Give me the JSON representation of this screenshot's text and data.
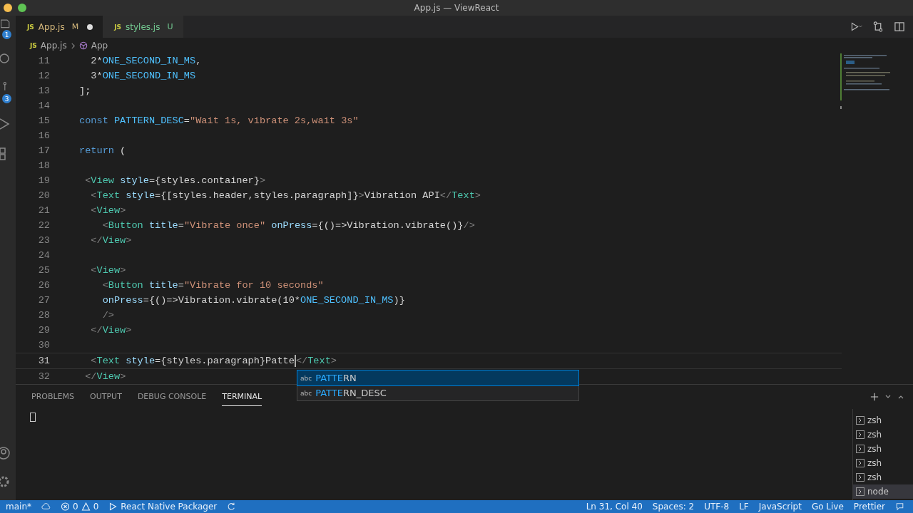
{
  "window": {
    "title": "App.js — ViewReact"
  },
  "activity_badges": [
    {
      "kind": "explorer",
      "count": "1"
    },
    {
      "kind": "scm",
      "count": "3"
    }
  ],
  "tabs": [
    {
      "file_icon": "JS",
      "label": "App.js",
      "status": "M",
      "modified": true,
      "selected": true
    },
    {
      "file_icon": "JS",
      "label": "styles.js",
      "status": "U",
      "modified": false,
      "selected": false
    }
  ],
  "breadcrumb": {
    "file_icon": "JS",
    "file": "App.js",
    "symbol": "App"
  },
  "editor": {
    "lines": [
      {
        "number": "11",
        "current": false,
        "tokens": [
          {
            "kind": "plain",
            "text": "  2*"
          },
          {
            "kind": "const",
            "text": "ONE_SECOND_IN_MS"
          },
          {
            "kind": "plain",
            "text": ","
          }
        ]
      },
      {
        "number": "12",
        "current": false,
        "tokens": [
          {
            "kind": "plain",
            "text": "  3*"
          },
          {
            "kind": "const",
            "text": "ONE_SECOND_IN_MS"
          }
        ]
      },
      {
        "number": "13",
        "current": false,
        "tokens": [
          {
            "kind": "plain",
            "text": "];"
          }
        ]
      },
      {
        "number": "14",
        "current": false
      },
      {
        "number": "15",
        "current": false,
        "tokens": [
          {
            "kind": "keyword",
            "text": "const "
          },
          {
            "kind": "const",
            "text": "PATTERN_DESC"
          },
          {
            "kind": "plain",
            "text": "="
          },
          {
            "kind": "string",
            "text": "\"Wait 1s, vibrate 2s,wait 3s\""
          }
        ]
      },
      {
        "number": "16",
        "current": false
      },
      {
        "number": "17",
        "current": false,
        "tokens": [
          {
            "kind": "keyword",
            "text": "return"
          },
          {
            "kind": "plain",
            "text": " ("
          }
        ]
      },
      {
        "number": "18",
        "current": false
      },
      {
        "number": "19",
        "current": false,
        "tokens": [
          {
            "kind": "punct",
            "text": " <"
          },
          {
            "kind": "tag",
            "text": "View"
          },
          {
            "kind": "attr",
            "text": " style"
          },
          {
            "kind": "plain",
            "text": "={styles.container}"
          },
          {
            "kind": "punct",
            "text": ">"
          }
        ]
      },
      {
        "number": "20",
        "current": false,
        "tokens": [
          {
            "kind": "punct",
            "text": "  <"
          },
          {
            "kind": "tag",
            "text": "Text"
          },
          {
            "kind": "attr",
            "text": " style"
          },
          {
            "kind": "plain",
            "text": "={[styles.header,styles.paragraph]}"
          },
          {
            "kind": "punct",
            "text": ">"
          },
          {
            "kind": "plain",
            "text": "Vibration API"
          },
          {
            "kind": "punct",
            "text": "</"
          },
          {
            "kind": "tag",
            "text": "Text"
          },
          {
            "kind": "punct",
            "text": ">"
          }
        ]
      },
      {
        "number": "21",
        "current": false,
        "tokens": [
          {
            "kind": "punct",
            "text": "  <"
          },
          {
            "kind": "tag",
            "text": "View"
          },
          {
            "kind": "punct",
            "text": ">"
          }
        ]
      },
      {
        "number": "22",
        "current": false,
        "tokens": [
          {
            "kind": "punct",
            "text": "    <"
          },
          {
            "kind": "tag",
            "text": "Button"
          },
          {
            "kind": "attr",
            "text": " title"
          },
          {
            "kind": "plain",
            "text": "="
          },
          {
            "kind": "string",
            "text": "\"Vibrate once\""
          },
          {
            "kind": "attr",
            "text": " onPress"
          },
          {
            "kind": "plain",
            "text": "={()=>Vibration.vibrate()}"
          },
          {
            "kind": "punct",
            "text": "/>"
          }
        ]
      },
      {
        "number": "23",
        "current": false,
        "tokens": [
          {
            "kind": "punct",
            "text": "  </"
          },
          {
            "kind": "tag",
            "text": "View"
          },
          {
            "kind": "punct",
            "text": ">"
          }
        ]
      },
      {
        "number": "24",
        "current": false
      },
      {
        "number": "25",
        "current": false,
        "tokens": [
          {
            "kind": "punct",
            "text": "  <"
          },
          {
            "kind": "tag",
            "text": "View"
          },
          {
            "kind": "punct",
            "text": ">"
          }
        ]
      },
      {
        "number": "26",
        "current": false,
        "tokens": [
          {
            "kind": "punct",
            "text": "    <"
          },
          {
            "kind": "tag",
            "text": "Button"
          },
          {
            "kind": "attr",
            "text": " title"
          },
          {
            "kind": "plain",
            "text": "="
          },
          {
            "kind": "string",
            "text": "\"Vibrate for 10 seconds\""
          }
        ]
      },
      {
        "number": "27",
        "current": false,
        "tokens": [
          {
            "kind": "attr",
            "text": "    onPress"
          },
          {
            "kind": "plain",
            "text": "={()=>Vibration.vibrate(10*"
          },
          {
            "kind": "const",
            "text": "ONE_SECOND_IN_MS"
          },
          {
            "kind": "plain",
            "text": ")}"
          }
        ]
      },
      {
        "number": "28",
        "current": false,
        "tokens": [
          {
            "kind": "punct",
            "text": "    />"
          }
        ]
      },
      {
        "number": "29",
        "current": false,
        "tokens": [
          {
            "kind": "punct",
            "text": "  </"
          },
          {
            "kind": "tag",
            "text": "View"
          },
          {
            "kind": "punct",
            "text": ">"
          }
        ]
      },
      {
        "number": "30",
        "current": false
      },
      {
        "number": "31",
        "current": true,
        "tokens": [
          {
            "kind": "punct",
            "text": "  <"
          },
          {
            "kind": "tag",
            "text": "Text"
          },
          {
            "kind": "attr",
            "text": " style"
          },
          {
            "kind": "plain",
            "text": "={styles.paragraph}"
          },
          {
            "kind": "plain",
            "text": "Patte",
            "caret": true
          },
          {
            "kind": "punct",
            "text": "</"
          },
          {
            "kind": "tag",
            "text": "Text"
          },
          {
            "kind": "punct",
            "text": ">"
          }
        ]
      },
      {
        "number": "32",
        "current": false,
        "tokens": [
          {
            "kind": "punct",
            "text": " </"
          },
          {
            "kind": "tag",
            "text": "View"
          },
          {
            "kind": "punct",
            "text": ">"
          }
        ]
      }
    ]
  },
  "suggestions": [
    {
      "type": "abc",
      "match": "PATTE",
      "rest": "RN",
      "selected": true
    },
    {
      "type": "abc",
      "match": "PATTE",
      "rest": "RN_DESC",
      "selected": false
    }
  ],
  "panel": {
    "tabs": [
      {
        "label": "PROBLEMS",
        "selected": false
      },
      {
        "label": "OUTPUT",
        "selected": false
      },
      {
        "label": "DEBUG CONSOLE",
        "selected": false
      },
      {
        "label": "TERMINAL",
        "selected": true
      }
    ],
    "terminals": [
      {
        "label": "zsh",
        "selected": false
      },
      {
        "label": "zsh",
        "selected": false
      },
      {
        "label": "zsh",
        "selected": false
      },
      {
        "label": "zsh",
        "selected": false
      },
      {
        "label": "zsh",
        "selected": false
      },
      {
        "label": "node",
        "selected": true
      }
    ]
  },
  "status_bar": {
    "branch": "main*",
    "errors": "0",
    "warnings": "0",
    "packager": "React Native Packager",
    "position": "Ln 31, Col 40",
    "spaces": "Spaces: 2",
    "encoding": "UTF-8",
    "eol": "LF",
    "language": "JavaScript",
    "live": "Go Live",
    "formatter": "Prettier"
  }
}
